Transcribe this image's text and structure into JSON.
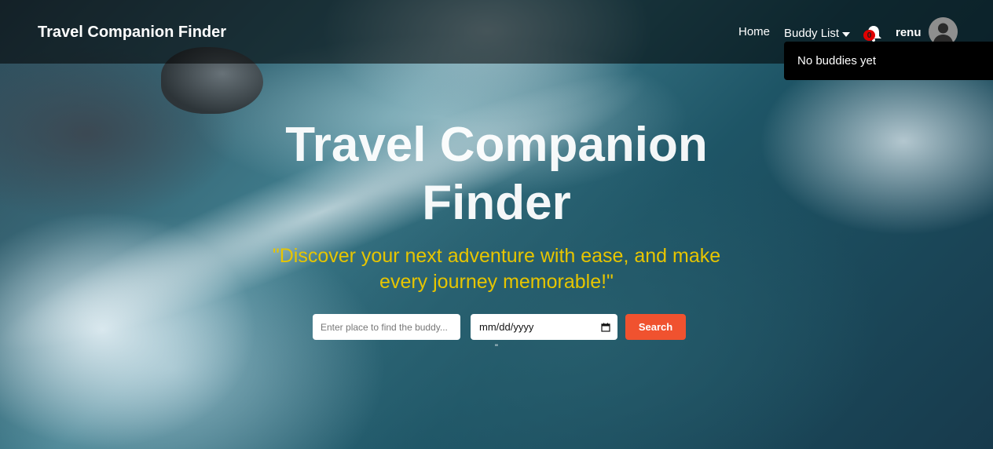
{
  "navbar": {
    "brand": "Travel Companion Finder",
    "home_label": "Home",
    "buddy_list_label": "Buddy List",
    "notification_count": "0",
    "username": "renu"
  },
  "dropdown": {
    "items": [
      "No buddies yet"
    ]
  },
  "hero": {
    "title": "Travel Companion Finder",
    "tagline": "\"Discover your next adventure with ease, and make every journey memorable!\""
  },
  "search": {
    "place_placeholder": "Enter place to find the buddy...",
    "date_value": "mm/dd/yyyy",
    "button_label": "Search",
    "stray_text": "\""
  },
  "colors": {
    "accent": "#f0522f",
    "tagline": "#e7c500",
    "badge": "#e00000"
  },
  "icons": [
    "bell-icon",
    "caret-down-icon",
    "user-avatar-icon",
    "calendar-icon"
  ]
}
